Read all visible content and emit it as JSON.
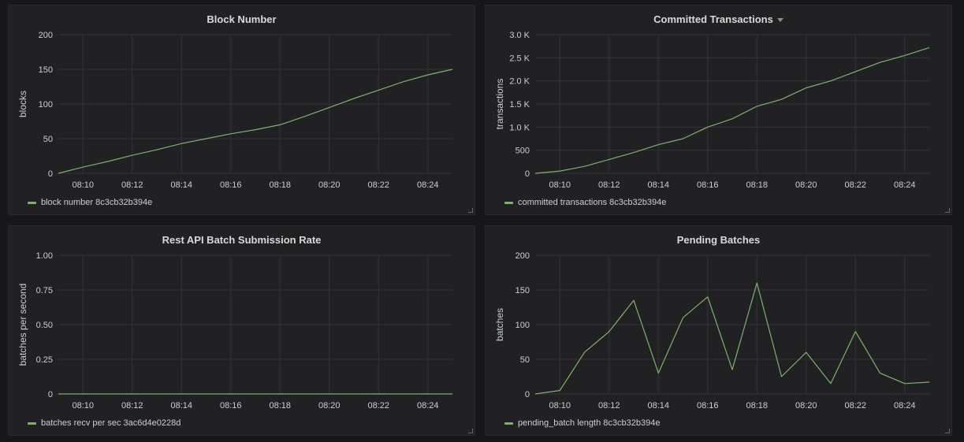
{
  "colors": {
    "series": "#7eb26d",
    "grid": "#333338",
    "text": "#c7d0d9"
  },
  "panels": [
    {
      "title": "Block Number",
      "has_menu": false,
      "legend": "block number 8c3cb32b394e"
    },
    {
      "title": "Committed Transactions",
      "has_menu": true,
      "legend": "committed transactions 8c3cb32b394e"
    },
    {
      "title": "Rest API Batch Submission Rate",
      "has_menu": false,
      "legend": "batches recv per sec 3ac6d4e0228d"
    },
    {
      "title": "Pending Batches",
      "has_menu": false,
      "legend": "pending_batch length 8c3cb32b394e"
    }
  ],
  "chart_data": [
    {
      "type": "line",
      "title": "Block Number",
      "ylabel": "blocks",
      "xlabel": "",
      "x_ticks": [
        "08:10",
        "08:12",
        "08:14",
        "08:16",
        "08:18",
        "08:20",
        "08:22",
        "08:24"
      ],
      "y_ticks": [
        "0",
        "50",
        "100",
        "150",
        "200"
      ],
      "ylim": [
        0,
        200
      ],
      "xlim": [
        "08:09",
        "08:25"
      ],
      "grid": true,
      "legend_position": "bottom-left",
      "series": [
        {
          "name": "block number 8c3cb32b394e",
          "x": [
            "08:09",
            "08:10",
            "08:11",
            "08:12",
            "08:13",
            "08:14",
            "08:15",
            "08:16",
            "08:17",
            "08:18",
            "08:19",
            "08:20",
            "08:21",
            "08:22",
            "08:23",
            "08:24",
            "08:25"
          ],
          "values": [
            0,
            9,
            17,
            26,
            34,
            43,
            50,
            57,
            63,
            70,
            82,
            95,
            108,
            120,
            132,
            142,
            150
          ]
        }
      ]
    },
    {
      "type": "line",
      "title": "Committed Transactions",
      "ylabel": "transactions",
      "xlabel": "",
      "x_ticks": [
        "08:10",
        "08:12",
        "08:14",
        "08:16",
        "08:18",
        "08:20",
        "08:22",
        "08:24"
      ],
      "y_ticks": [
        "0",
        "500",
        "1.0 K",
        "1.5 K",
        "2.0 K",
        "2.5 K",
        "3.0 K"
      ],
      "ylim": [
        0,
        3000
      ],
      "xlim": [
        "08:09",
        "08:25"
      ],
      "grid": true,
      "legend_position": "bottom-left",
      "series": [
        {
          "name": "committed transactions 8c3cb32b394e",
          "x": [
            "08:09",
            "08:10",
            "08:11",
            "08:12",
            "08:13",
            "08:14",
            "08:15",
            "08:16",
            "08:17",
            "08:18",
            "08:19",
            "08:20",
            "08:21",
            "08:22",
            "08:23",
            "08:24",
            "08:25"
          ],
          "values": [
            0,
            50,
            150,
            300,
            450,
            620,
            750,
            1000,
            1180,
            1450,
            1600,
            1850,
            2000,
            2200,
            2400,
            2550,
            2720
          ]
        }
      ]
    },
    {
      "type": "line",
      "title": "Rest API Batch Submission Rate",
      "ylabel": "batches per second",
      "xlabel": "",
      "x_ticks": [
        "08:10",
        "08:12",
        "08:14",
        "08:16",
        "08:18",
        "08:20",
        "08:22",
        "08:24"
      ],
      "y_ticks": [
        "0",
        "0.25",
        "0.50",
        "0.75",
        "1.00"
      ],
      "ylim": [
        0,
        1
      ],
      "xlim": [
        "08:09",
        "08:25"
      ],
      "grid": true,
      "legend_position": "bottom-left",
      "series": [
        {
          "name": "batches recv per sec 3ac6d4e0228d",
          "x": [
            "08:09",
            "08:25"
          ],
          "values": [
            0,
            0
          ]
        }
      ]
    },
    {
      "type": "line",
      "title": "Pending Batches",
      "ylabel": "batches",
      "xlabel": "",
      "x_ticks": [
        "08:10",
        "08:12",
        "08:14",
        "08:16",
        "08:18",
        "08:20",
        "08:22",
        "08:24"
      ],
      "y_ticks": [
        "0",
        "50",
        "100",
        "150",
        "200"
      ],
      "ylim": [
        0,
        200
      ],
      "xlim": [
        "08:09",
        "08:25"
      ],
      "grid": true,
      "legend_position": "bottom-left",
      "series": [
        {
          "name": "pending_batch length 8c3cb32b394e",
          "x": [
            "08:09",
            "08:10",
            "08:11",
            "08:12",
            "08:13",
            "08:14",
            "08:15",
            "08:16",
            "08:17",
            "08:18",
            "08:19",
            "08:20",
            "08:21",
            "08:22",
            "08:23",
            "08:24",
            "08:25"
          ],
          "values": [
            0,
            5,
            60,
            90,
            135,
            30,
            110,
            140,
            35,
            160,
            25,
            60,
            15,
            90,
            30,
            15,
            17
          ]
        }
      ]
    }
  ]
}
